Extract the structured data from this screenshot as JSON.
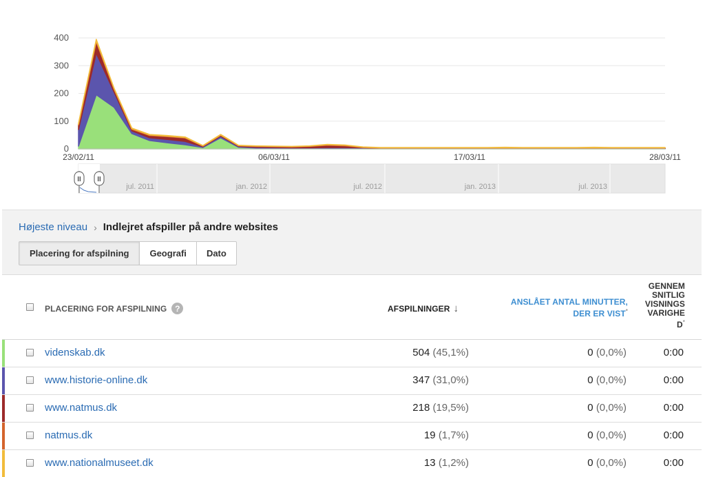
{
  "chart_data": {
    "type": "area",
    "stacked": true,
    "y_ticks": [
      "400",
      "300",
      "200",
      "100",
      "0"
    ],
    "ylim": [
      0,
      400
    ],
    "x_labels": [
      "23/02/11",
      "06/03/11",
      "17/03/11",
      "28/03/11"
    ],
    "days": [
      "23/02/11",
      "24/02/11",
      "25/02/11",
      "26/02/11",
      "27/02/11",
      "28/02/11",
      "01/03/11",
      "02/03/11",
      "03/03/11",
      "04/03/11",
      "05/03/11",
      "06/03/11",
      "07/03/11",
      "08/03/11",
      "09/03/11",
      "10/03/11",
      "11/03/11",
      "12/03/11",
      "13/03/11",
      "14/03/11",
      "15/03/11",
      "16/03/11",
      "17/03/11",
      "18/03/11",
      "19/03/11",
      "20/03/11",
      "21/03/11",
      "22/03/11",
      "23/03/11",
      "24/03/11",
      "25/03/11",
      "26/03/11",
      "27/03/11",
      "28/03/11"
    ],
    "series": [
      {
        "name": "videnskab.dk",
        "color": "#99e07a",
        "values": [
          10,
          195,
          150,
          55,
          30,
          22,
          15,
          5,
          40,
          6,
          3,
          2,
          2,
          2,
          2,
          2,
          2,
          1,
          1,
          1,
          1,
          1,
          1,
          1,
          1,
          1,
          1,
          1,
          1,
          1,
          1,
          1,
          1,
          1
        ]
      },
      {
        "name": "www.historie-online.dk",
        "color": "#5b55ad",
        "values": [
          60,
          150,
          55,
          10,
          10,
          12,
          12,
          3,
          6,
          3,
          3,
          3,
          2,
          2,
          3,
          3,
          2,
          1,
          1,
          1,
          1,
          1,
          1,
          1,
          1,
          1,
          1,
          1,
          1,
          1,
          1,
          1,
          1,
          1
        ]
      },
      {
        "name": "www.natmus.dk",
        "color": "#9c2a2a",
        "values": [
          15,
          40,
          10,
          5,
          8,
          10,
          12,
          2,
          3,
          2,
          3,
          3,
          3,
          5,
          8,
          6,
          1,
          1,
          1,
          1,
          1,
          1,
          1,
          1,
          1,
          1,
          1,
          1,
          1,
          1,
          1,
          1,
          1,
          1
        ]
      },
      {
        "name": "natmus.dk",
        "color": "#d4642c",
        "values": [
          4,
          5,
          2,
          3,
          2,
          2,
          2,
          1,
          1,
          1,
          1,
          1,
          1,
          1,
          2,
          2,
          1,
          1,
          1,
          1,
          1,
          1,
          1,
          1,
          1,
          1,
          1,
          1,
          1,
          1,
          1,
          1,
          1,
          1
        ]
      },
      {
        "name": "www.nationalmuseet.dk",
        "color": "#f2bc3b",
        "values": [
          3,
          5,
          2,
          2,
          2,
          2,
          2,
          1,
          2,
          1,
          1,
          1,
          1,
          1,
          1,
          1,
          1,
          1,
          1,
          1,
          1,
          1,
          1,
          1,
          2,
          1,
          1,
          1,
          1,
          2,
          1,
          1,
          1,
          1
        ]
      }
    ],
    "navigator": {
      "labels": [
        "jul. 2011",
        "jan. 2012",
        "jul. 2012",
        "jan. 2013",
        "jul. 2013"
      ],
      "handle_glyph": "II"
    }
  },
  "breadcrumb": {
    "root": "Højeste niveau",
    "separator": "›",
    "current": "Indlejret afspiller på andre websites"
  },
  "tabs": [
    {
      "label": "Placering for afspilning",
      "active": true
    },
    {
      "label": "Geografi",
      "active": false
    },
    {
      "label": "Dato",
      "active": false
    }
  ],
  "table": {
    "headers": {
      "location": "PLACERING FOR AFSPILNING",
      "help_icon": "?",
      "plays": "AFSPILNINGER",
      "sort_icon": "↓",
      "minutes_line1": "ANSLÅET ANTAL MINUTTER,",
      "minutes_line2": "DER ER VIST",
      "minutes_mark": "*",
      "duration_lines": [
        "GENNEM",
        "SNITLIG",
        "VISNINGS",
        "VARIGHE",
        "D"
      ],
      "duration_mark": "*"
    },
    "rows": [
      {
        "name": "videnskab.dk",
        "color": "#99e07a",
        "plays": "504",
        "plays_pct": "(45,1%)",
        "minutes": "0",
        "minutes_pct": "(0,0%)",
        "duration": "0:00"
      },
      {
        "name": "www.historie-online.dk",
        "color": "#5b55ad",
        "plays": "347",
        "plays_pct": "(31,0%)",
        "minutes": "0",
        "minutes_pct": "(0,0%)",
        "duration": "0:00"
      },
      {
        "name": "www.natmus.dk",
        "color": "#9c2a2a",
        "plays": "218",
        "plays_pct": "(19,5%)",
        "minutes": "0",
        "minutes_pct": "(0,0%)",
        "duration": "0:00"
      },
      {
        "name": "natmus.dk",
        "color": "#d4642c",
        "plays": "19",
        "plays_pct": "(1,7%)",
        "minutes": "0",
        "minutes_pct": "(0,0%)",
        "duration": "0:00"
      },
      {
        "name": "www.nationalmuseet.dk",
        "color": "#f2bc3b",
        "plays": "13",
        "plays_pct": "(1,2%)",
        "minutes": "0",
        "minutes_pct": "(0,0%)",
        "duration": "0:00"
      }
    ]
  },
  "colors": {
    "link": "#2a6bb3",
    "header_link": "#3d8ed1",
    "navigator_fill": "#e9e9e9"
  }
}
